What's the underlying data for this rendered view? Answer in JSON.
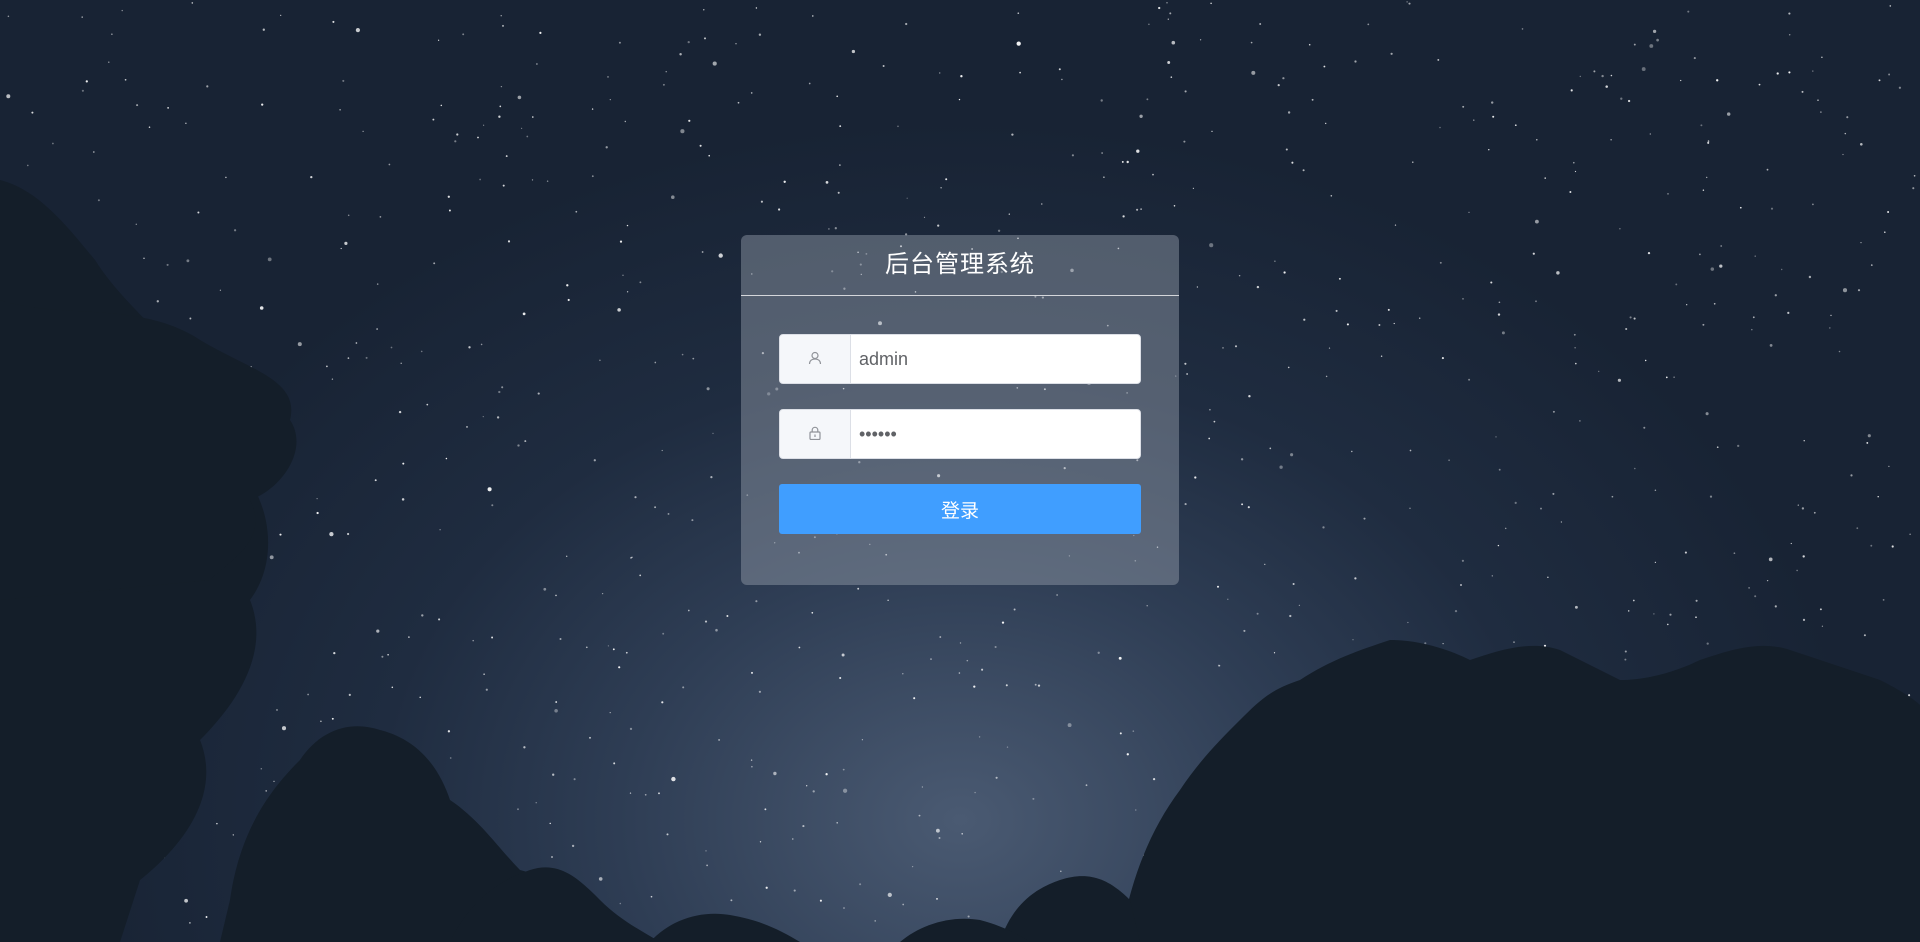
{
  "app": {
    "title": "后台管理系统"
  },
  "form": {
    "username": {
      "value": "admin",
      "icon": "user-icon"
    },
    "password": {
      "value": "••••••",
      "icon": "lock-icon"
    },
    "submit_label": "登录"
  },
  "colors": {
    "primary": "#409eff",
    "panel": "rgba(150,160,172,0.45)",
    "sky": "#1f2c40"
  }
}
